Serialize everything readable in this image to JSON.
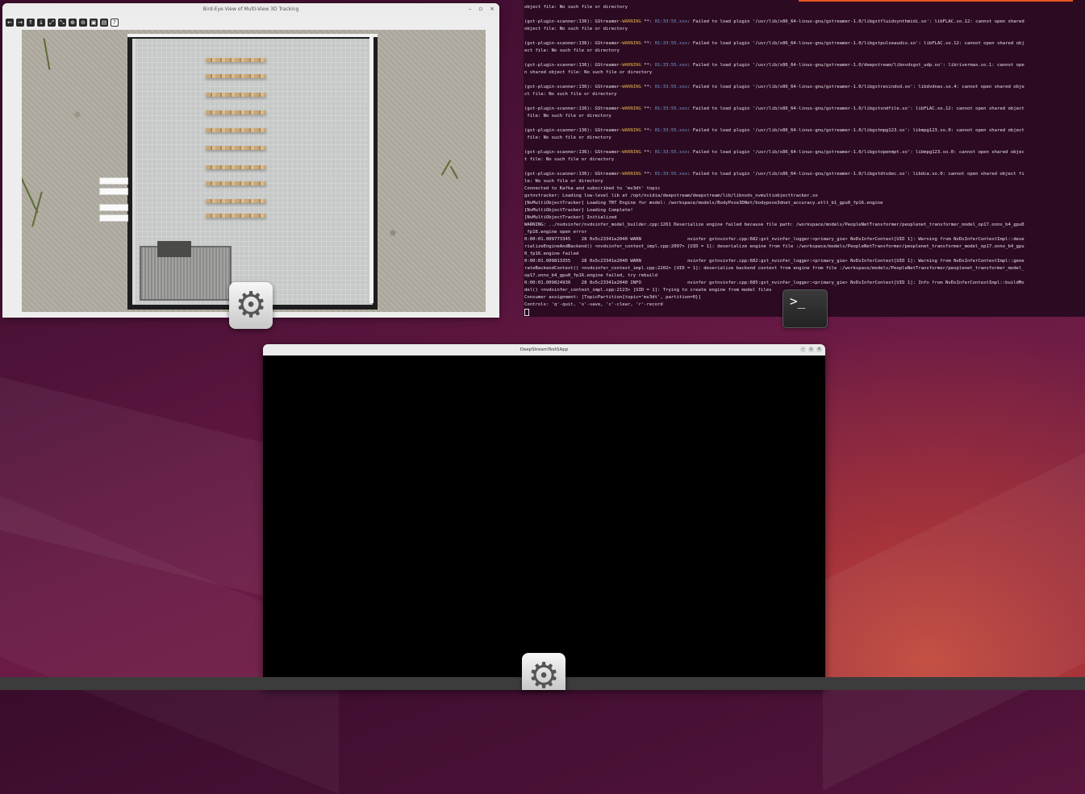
{
  "bev_window": {
    "title": "Bird-Eye View of Multi-View 3D Tracking",
    "controls": [
      "–",
      "▫",
      "×"
    ],
    "toolbar": [
      {
        "name": "back",
        "glyph": "←"
      },
      {
        "name": "forward",
        "glyph": "→"
      },
      {
        "name": "up",
        "glyph": "↑"
      },
      {
        "name": "down",
        "glyph": "↓"
      },
      {
        "name": "fit",
        "glyph": "⤢"
      },
      {
        "name": "fit2",
        "glyph": "⤡"
      },
      {
        "name": "zoom-in",
        "glyph": "⊕"
      },
      {
        "name": "zoom-out",
        "glyph": "⊖"
      },
      {
        "name": "save",
        "glyph": "▣"
      },
      {
        "name": "close-sub",
        "glyph": "▤"
      },
      {
        "name": "help",
        "glyph": "?"
      }
    ]
  },
  "terminal": {
    "lines": [
      {
        "text": "object file: No such file or directory"
      },
      {
        "text": ""
      },
      {
        "prefix": "(gst-plugin-scanner:136): GStreamer-",
        "warn": "WARNING",
        "mid": " **: ",
        "ts": "01:33:55.xxx",
        "rest": ": Failed to load plugin '/usr/lib/x86_64-linux-gnu/gstreamer-1.0/libgstfluidsynthmidi.so': libFLAC.so.12: cannot open shared"
      },
      {
        "text": "object file: No such file or directory"
      },
      {
        "text": ""
      },
      {
        "prefix": "(gst-plugin-scanner:136): GStreamer-",
        "warn": "WARNING",
        "mid": " **: ",
        "ts": "01:33:55.xxx",
        "rest": ": Failed to load plugin '/usr/lib/x86_64-linux-gnu/gstreamer-1.0/libgstpulseaudio.so': libFLAC.so.12: cannot open shared obj"
      },
      {
        "text": "ect file: No such file or directory"
      },
      {
        "text": ""
      },
      {
        "prefix": "(gst-plugin-scanner:136): GStreamer-",
        "warn": "WARNING",
        "mid": " **: ",
        "ts": "01:33:55.xxx",
        "rest": ": Failed to load plugin '/usr/lib/x86_64-linux-gnu/gstreamer-1.0/deepstream/libnvdsgst_udp.so': librivermax.so.1: cannot ope"
      },
      {
        "text": "n shared object file: No such file or directory"
      },
      {
        "text": ""
      },
      {
        "prefix": "(gst-plugin-scanner:136): GStreamer-",
        "warn": "WARNING",
        "mid": " **: ",
        "ts": "01:33:55.xxx",
        "rest": ": Failed to load plugin '/usr/lib/x86_64-linux-gnu/gstreamer-1.0/libgstresindvd.so': libdvdnav.so.4: cannot open shared obje"
      },
      {
        "text": "ct file: No such file or directory"
      },
      {
        "text": ""
      },
      {
        "prefix": "(gst-plugin-scanner:136): GStreamer-",
        "warn": "WARNING",
        "mid": " **: ",
        "ts": "01:33:55.xxx",
        "rest": ": Failed to load plugin '/usr/lib/x86_64-linux-gnu/gstreamer-1.0/libgstsndfile.so': libFLAC.so.12: cannot open shared object"
      },
      {
        "text": " file: No such file or directory"
      },
      {
        "text": ""
      },
      {
        "prefix": "(gst-plugin-scanner:136): GStreamer-",
        "warn": "WARNING",
        "mid": " **: ",
        "ts": "01:33:55.xxx",
        "rest": ": Failed to load plugin '/usr/lib/x86_64-linux-gnu/gstreamer-1.0/libgstmpg123.so': libmpg123.so.0: cannot open shared object"
      },
      {
        "text": " file: No such file or directory"
      },
      {
        "text": ""
      },
      {
        "prefix": "(gst-plugin-scanner:136): GStreamer-",
        "warn": "WARNING",
        "mid": " **: ",
        "ts": "01:33:55.xxx",
        "rest": ": Failed to load plugin '/usr/lib/x86_64-linux-gnu/gstreamer-1.0/libgstopenmpt.so': libmpg123.so.0: cannot open shared objec"
      },
      {
        "text": "t file: No such file or directory"
      },
      {
        "text": ""
      },
      {
        "prefix": "(gst-plugin-scanner:136): GStreamer-",
        "warn": "WARNING",
        "mid": " **: ",
        "ts": "01:33:55.xxx",
        "rest": ": Failed to load plugin '/usr/lib/x86_64-linux-gnu/gstreamer-1.0/libgstdtsdec.so': libdca.so.0: cannot open shared object fi"
      },
      {
        "text": "le: No such file or directory"
      },
      {
        "text": "Connected to Kafka and subscribed to 'mv3dt' topic"
      },
      {
        "text": "gstnvtracker: Loading low-level lib at /opt/nvidia/deepstream/deepstream/lib/libnvds_nvmultiobjecttracker.so"
      },
      {
        "text": "[NvMultiObjectTracker] Loading TRT Engine for model: /workspace/models/BodyPose3DNet/bodypose3dnet_accuracy.etlt_b1_gpu0_fp16.engine"
      },
      {
        "text": "[NvMultiObjectTracker] Loading Complete!"
      },
      {
        "text": "[NvMultiObjectTracker] Initialized"
      },
      {
        "text": "WARNING: ../nvdsinfer/nvdsinfer_model_builder.cpp:1261 Deserialize engine failed because file path: /workspace/models/PeopleNetTransformer/peoplenet_transformer_model_op17.onnx_b4_gpu0"
      },
      {
        "text": "_fp16.engine open error"
      },
      {
        "text": "0:00:01.009773345    28 0x5c23341e2040 WARN                 nvinfer gstnvinfer.cpp:682:gst_nvinfer_logger:<primary_gie> NvDsInferContext[UID 1]: Warning from NvDsInferContextImpl::dese"
      },
      {
        "text": "rializeEngineAndBackend() <nvdsinfer_context_impl.cpp:2097> [UID = 1]: deserialize engine from file :/workspace/models/PeopleNetTransformer/peoplenet_transformer_model_op17.onnx_b4_gpu"
      },
      {
        "text": "0_fp16.engine failed"
      },
      {
        "text": "0:00:01.009813355    28 0x5c23341e2040 WARN                 nvinfer gstnvinfer.cpp:682:gst_nvinfer_logger:<primary_gie> NvDsInferContext[UID 1]: Warning from NvDsInferContextImpl::gene"
      },
      {
        "text": "rateBackendContext() <nvdsinfer_context_impl.cpp:2202> [UID = 1]: deserialize backend context from engine from file :/workspace/models/PeopleNetTransformer/peoplenet_transformer_model_"
      },
      {
        "text": "op17.onnx_b4_gpu0_fp16.engine failed, try rebuild"
      },
      {
        "text": "0:00:01.009824930    28 0x5c23341e2040 INFO                 nvinfer gstnvinfer.cpp:685:gst_nvinfer_logger:<primary_gie> NvDsInferContext[UID 1]: Info from NvDsInferContextImpl::buildMo"
      },
      {
        "text": "del() <nvdsinfer_context_impl.cpp:2123> [UID = 1]: Trying to create engine from model files"
      },
      {
        "text": "Consumer assignment: [TopicPartition{topic='mv3dt', partition=0}]"
      },
      {
        "text": "Controls: 'q'-quit, 's'-save, 'c'-clear, 'r'-record"
      }
    ]
  },
  "ds_window": {
    "title": "DeepStreamTestSApp",
    "controls": [
      "–",
      "▫",
      "×"
    ]
  },
  "dock": {
    "settings_icon": "gear-icon",
    "terminal_icon": "terminal-icon",
    "terminal_glyph": ">_",
    "gear_glyph": "⚙"
  },
  "colors": {
    "terminal_bg": "#2c0b22",
    "warning": "#e0b045",
    "timestamp": "#6f9bd6",
    "ubuntu_orange": "#e95420"
  }
}
